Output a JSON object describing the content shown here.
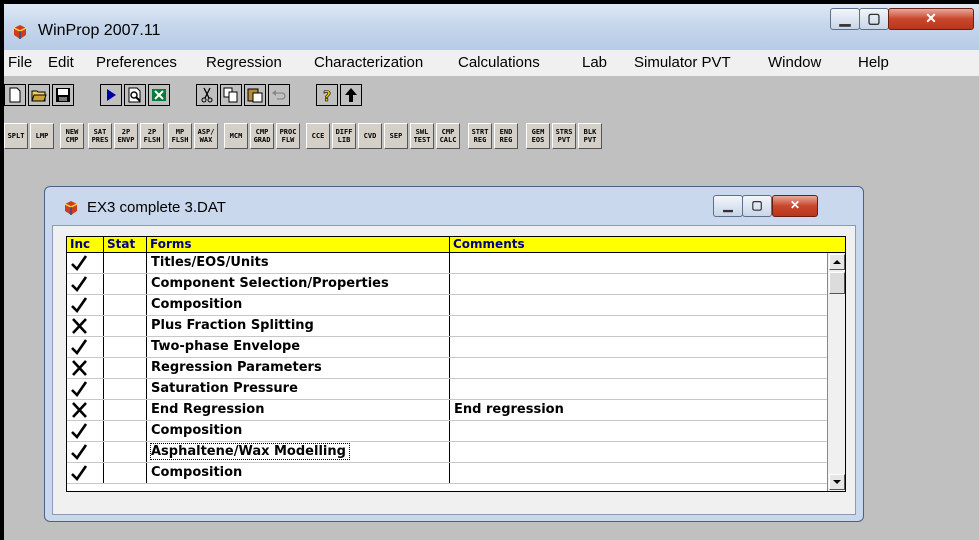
{
  "window": {
    "title": "WinProp 2007.11"
  },
  "menu": [
    "File",
    "Edit",
    "Preferences",
    "Regression",
    "Characterization",
    "Calculations",
    "Lab",
    "Simulator PVT",
    "Window",
    "Help"
  ],
  "toolbar_icons": [
    "new-document",
    "open-folder",
    "save",
    "run",
    "print-preview",
    "excel",
    "cut",
    "copy",
    "paste",
    "undo",
    "help",
    "up-arrow"
  ],
  "toolbar2": [
    {
      "label": "SPLT"
    },
    {
      "label": "LMP"
    },
    {
      "label": "NEW\nCMP"
    },
    {
      "label": "SAT\nPRES"
    },
    {
      "label": "2P\nENVP"
    },
    {
      "label": "2P\nFLSH"
    },
    {
      "label": "MP\nFLSH"
    },
    {
      "label": "ASP/\nWAX"
    },
    {
      "label": "MCM"
    },
    {
      "label": "CMP\nGRAD"
    },
    {
      "label": "PROC\nFLW"
    },
    {
      "label": "CCE"
    },
    {
      "label": "DIFF\nLIB"
    },
    {
      "label": "CVD"
    },
    {
      "label": "SEP"
    },
    {
      "label": "SWL\nTEST"
    },
    {
      "label": "CMP\nCALC"
    },
    {
      "label": "STRT\nREG"
    },
    {
      "label": "END\nREG"
    },
    {
      "label": "GEM\nEOS"
    },
    {
      "label": "STRS\nPVT"
    },
    {
      "label": "BLK\nPVT"
    }
  ],
  "child": {
    "title": "EX3 complete 3.DAT",
    "columns": [
      "Inc",
      "Stat",
      "Forms",
      "Comments"
    ],
    "rows": [
      {
        "inc": "check",
        "stat": "",
        "form": "Titles/EOS/Units",
        "comment": ""
      },
      {
        "inc": "check",
        "stat": "",
        "form": "Component Selection/Properties",
        "comment": ""
      },
      {
        "inc": "check",
        "stat": "",
        "form": "Composition",
        "comment": ""
      },
      {
        "inc": "cross",
        "stat": "",
        "form": "Plus Fraction Splitting",
        "comment": ""
      },
      {
        "inc": "check",
        "stat": "",
        "form": "Two-phase Envelope",
        "comment": ""
      },
      {
        "inc": "cross",
        "stat": "",
        "form": "Regression Parameters",
        "comment": ""
      },
      {
        "inc": "check",
        "stat": "",
        "form": "Saturation Pressure",
        "comment": ""
      },
      {
        "inc": "cross",
        "stat": "",
        "form": "End Regression",
        "comment": "End regression"
      },
      {
        "inc": "check",
        "stat": "",
        "form": "Composition",
        "comment": ""
      },
      {
        "inc": "check",
        "stat": "",
        "form": "Asphaltene/Wax Modelling",
        "comment": "",
        "selected": true
      },
      {
        "inc": "check",
        "stat": "",
        "form": "Composition",
        "comment": ""
      }
    ]
  }
}
